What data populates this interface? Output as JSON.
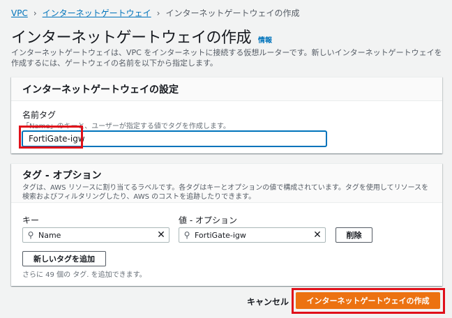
{
  "breadcrumb": {
    "items": [
      "VPC",
      "インターネットゲートウェイ",
      "インターネットゲートウェイの作成"
    ],
    "separator": "›"
  },
  "header": {
    "title": "インターネットゲートウェイの作成",
    "info_link": "情報",
    "description": "インターネットゲートウェイは、VPC をインターネットに接続する仮想ルーターです。新しいインターネットゲートウェイを作成するには、ゲートウェイの名前を以下から指定します。"
  },
  "settings": {
    "title": "インターネットゲートウェイの設定",
    "name_tag_label": "名前タグ",
    "name_tag_desc": "「Name」のキーと、ユーザーが指定する値でタグを作成します。",
    "name_tag_value": "FortiGate-igw"
  },
  "tags": {
    "title": "タグ - オプション",
    "description": "タグは、AWS リソースに割り当てるラベルです。各タグはキーとオプションの値で構成されています。タグを使用してリソースを検索およびフィルタリングしたり、AWS のコストを追跡したりできます。",
    "key_label": "キー",
    "value_label": "値 - オプション",
    "rows": [
      {
        "key": "Name",
        "value": "FortiGate-igw"
      }
    ],
    "remove_label": "削除",
    "add_tag_label": "新しいタグを追加",
    "remaining_hint": "さらに 49 個の タグ. を追加できます。"
  },
  "footer": {
    "cancel_label": "キャンセル",
    "create_label": "インターネットゲートウェイの作成"
  },
  "colors": {
    "link": "#0073bb",
    "primary": "#ec7211",
    "highlight": "#e0101a",
    "background": "#f2f3f3"
  }
}
